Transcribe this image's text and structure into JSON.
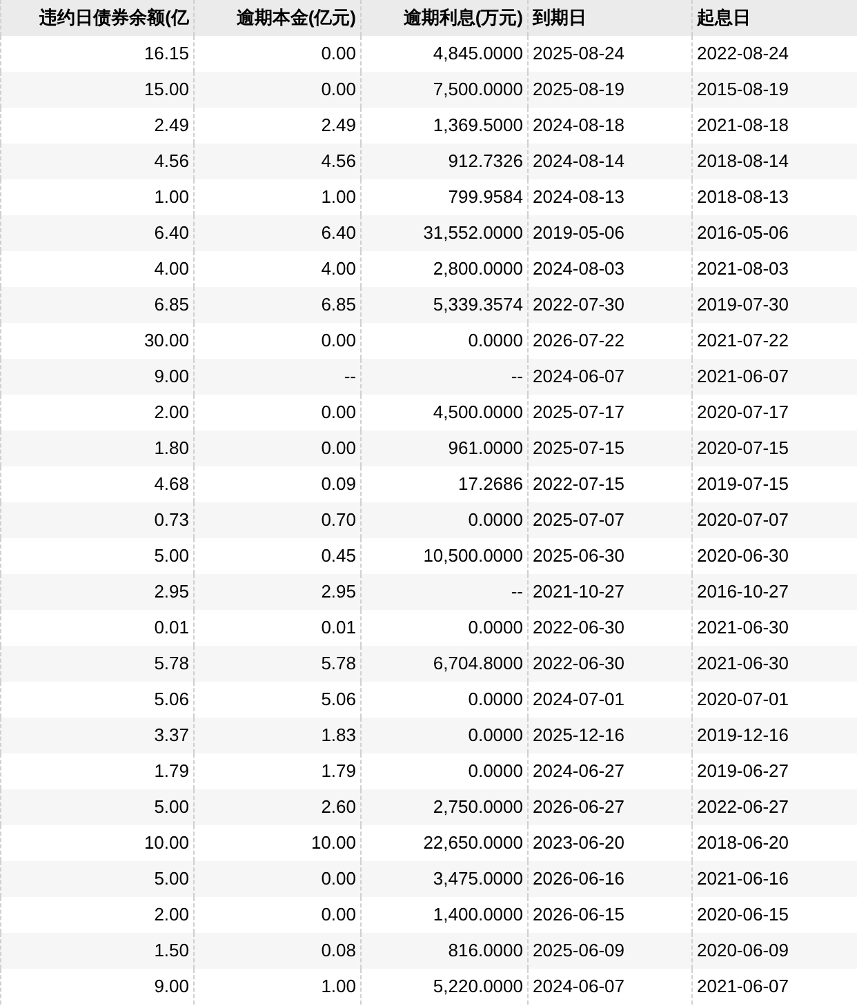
{
  "table": {
    "columns": [
      "违约日债券余额(亿",
      "逾期本金(亿元)",
      "逾期利息(万元)",
      "到期日",
      "起息日"
    ],
    "rows": [
      [
        "16.15",
        "0.00",
        "4,845.0000",
        "2025-08-24",
        "2022-08-24"
      ],
      [
        "15.00",
        "0.00",
        "7,500.0000",
        "2025-08-19",
        "2015-08-19"
      ],
      [
        "2.49",
        "2.49",
        "1,369.5000",
        "2024-08-18",
        "2021-08-18"
      ],
      [
        "4.56",
        "4.56",
        "912.7326",
        "2024-08-14",
        "2018-08-14"
      ],
      [
        "1.00",
        "1.00",
        "799.9584",
        "2024-08-13",
        "2018-08-13"
      ],
      [
        "6.40",
        "6.40",
        "31,552.0000",
        "2019-05-06",
        "2016-05-06"
      ],
      [
        "4.00",
        "4.00",
        "2,800.0000",
        "2024-08-03",
        "2021-08-03"
      ],
      [
        "6.85",
        "6.85",
        "5,339.3574",
        "2022-07-30",
        "2019-07-30"
      ],
      [
        "30.00",
        "0.00",
        "0.0000",
        "2026-07-22",
        "2021-07-22"
      ],
      [
        "9.00",
        "--",
        "--",
        "2024-06-07",
        "2021-06-07"
      ],
      [
        "2.00",
        "0.00",
        "4,500.0000",
        "2025-07-17",
        "2020-07-17"
      ],
      [
        "1.80",
        "0.00",
        "961.0000",
        "2025-07-15",
        "2020-07-15"
      ],
      [
        "4.68",
        "0.09",
        "17.2686",
        "2022-07-15",
        "2019-07-15"
      ],
      [
        "0.73",
        "0.70",
        "0.0000",
        "2025-07-07",
        "2020-07-07"
      ],
      [
        "5.00",
        "0.45",
        "10,500.0000",
        "2025-06-30",
        "2020-06-30"
      ],
      [
        "2.95",
        "2.95",
        "--",
        "2021-10-27",
        "2016-10-27"
      ],
      [
        "0.01",
        "0.01",
        "0.0000",
        "2022-06-30",
        "2021-06-30"
      ],
      [
        "5.78",
        "5.78",
        "6,704.8000",
        "2022-06-30",
        "2021-06-30"
      ],
      [
        "5.06",
        "5.06",
        "0.0000",
        "2024-07-01",
        "2020-07-01"
      ],
      [
        "3.37",
        "1.83",
        "0.0000",
        "2025-12-16",
        "2019-12-16"
      ],
      [
        "1.79",
        "1.79",
        "0.0000",
        "2024-06-27",
        "2019-06-27"
      ],
      [
        "5.00",
        "2.60",
        "2,750.0000",
        "2026-06-27",
        "2022-06-27"
      ],
      [
        "10.00",
        "10.00",
        "22,650.0000",
        "2023-06-20",
        "2018-06-20"
      ],
      [
        "5.00",
        "0.00",
        "3,475.0000",
        "2026-06-16",
        "2021-06-16"
      ],
      [
        "2.00",
        "0.00",
        "1,400.0000",
        "2026-06-15",
        "2020-06-15"
      ],
      [
        "1.50",
        "0.08",
        "816.0000",
        "2025-06-09",
        "2020-06-09"
      ],
      [
        "9.00",
        "1.00",
        "5,220.0000",
        "2024-06-07",
        "2021-06-07"
      ]
    ]
  }
}
